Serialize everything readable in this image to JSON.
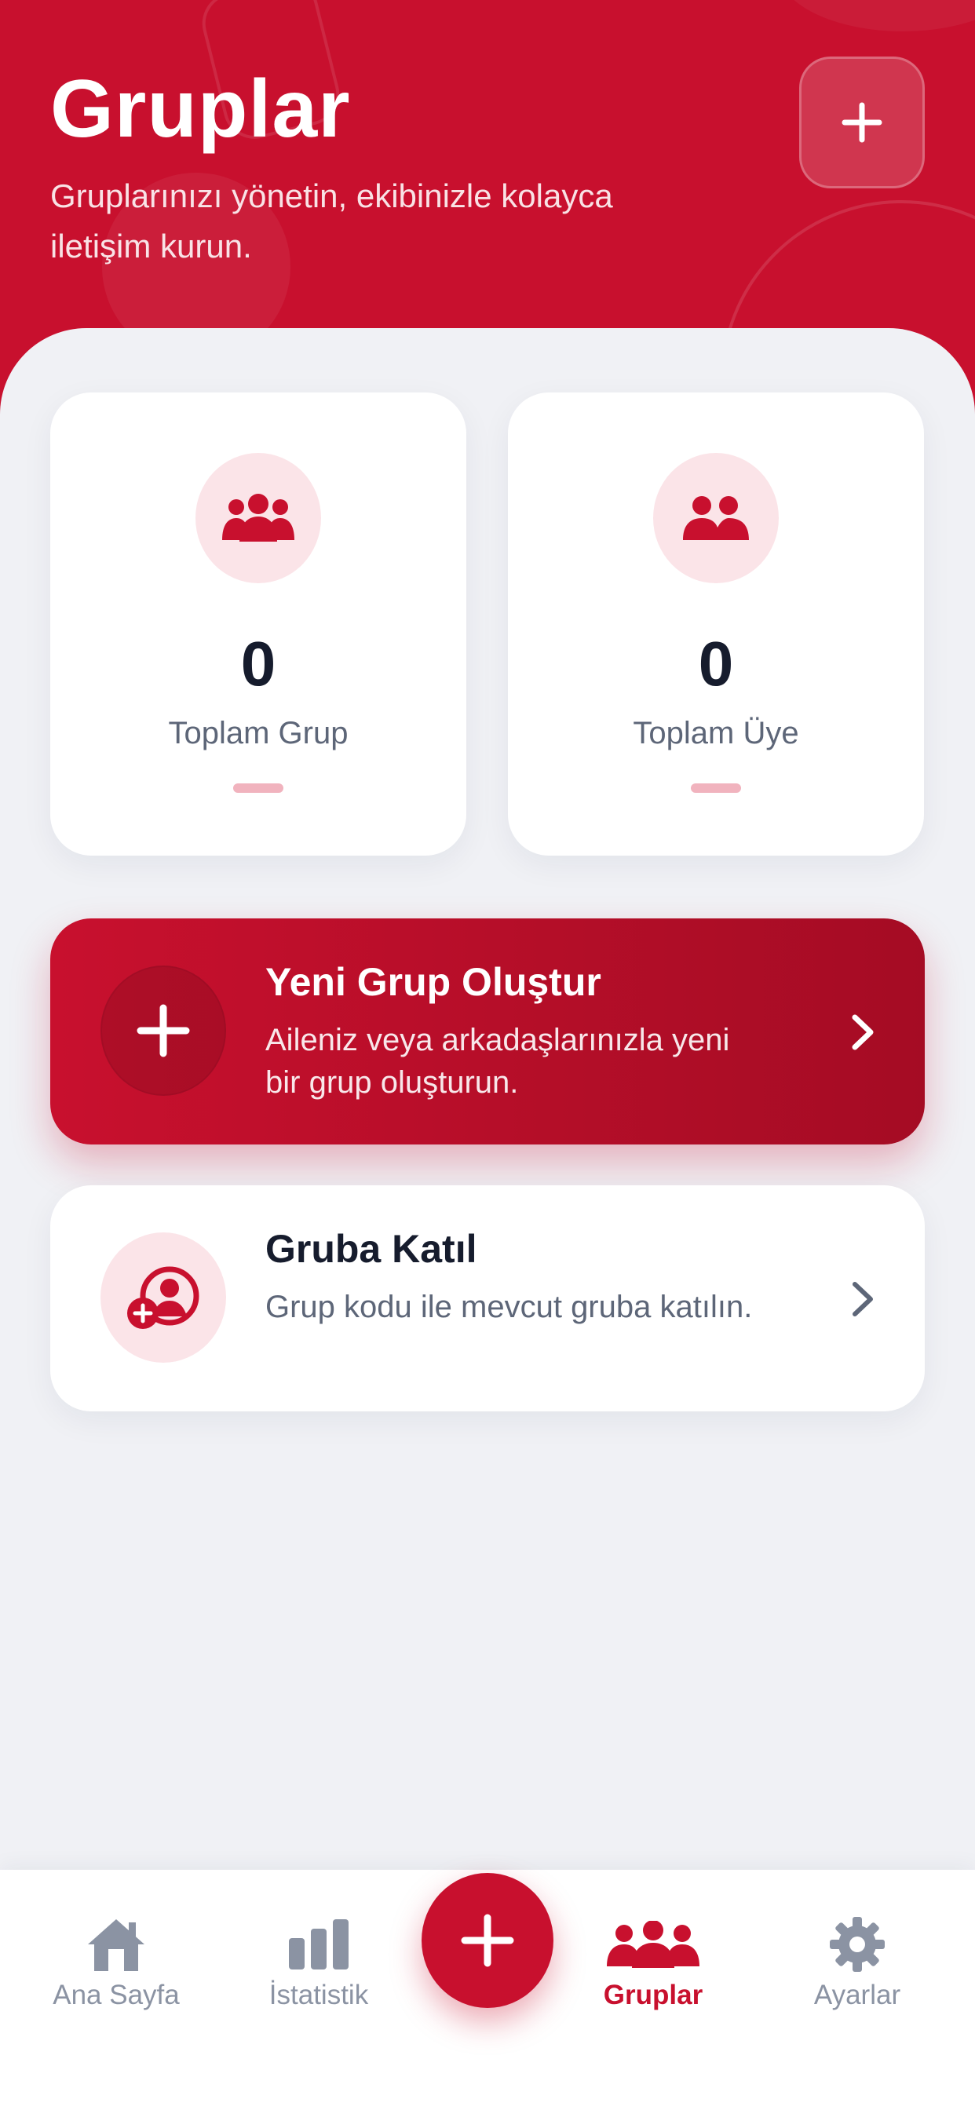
{
  "header": {
    "title": "Gruplar",
    "subtitle": "Gruplarınızı yönetin, ekibinizle kolayca iletişim kurun.",
    "add_icon": "plus-icon"
  },
  "stats": [
    {
      "icon": "groups-icon",
      "value": "0",
      "label": "Toplam Grup"
    },
    {
      "icon": "members-icon",
      "value": "0",
      "label": "Toplam Üye"
    }
  ],
  "actions": {
    "create": {
      "icon": "plus-icon",
      "title": "Yeni Grup Oluştur",
      "description": "Aileniz veya arkadaşlarınızla yeni bir grup oluşturun."
    },
    "join": {
      "icon": "user-add-icon",
      "title": "Gruba Katıl",
      "description": "Grup kodu ile mevcut gruba katılın."
    }
  },
  "tabbar": {
    "items": [
      {
        "label": "Ana Sayfa",
        "icon": "home-icon"
      },
      {
        "label": "İstatistik",
        "icon": "bar-chart-icon"
      },
      {
        "label": "Gruplar",
        "icon": "groups-icon",
        "active": true
      },
      {
        "label": "Ayarlar",
        "icon": "gear-icon"
      }
    ],
    "fab_icon": "plus-icon"
  },
  "colors": {
    "brand": "#c8102e",
    "background": "#f0f1f5",
    "card": "#ffffff",
    "icon_bg": "#fbe4e8",
    "text_dark": "#161c2d",
    "text_muted": "#5d6678",
    "tab_inactive": "#8b93a3"
  }
}
